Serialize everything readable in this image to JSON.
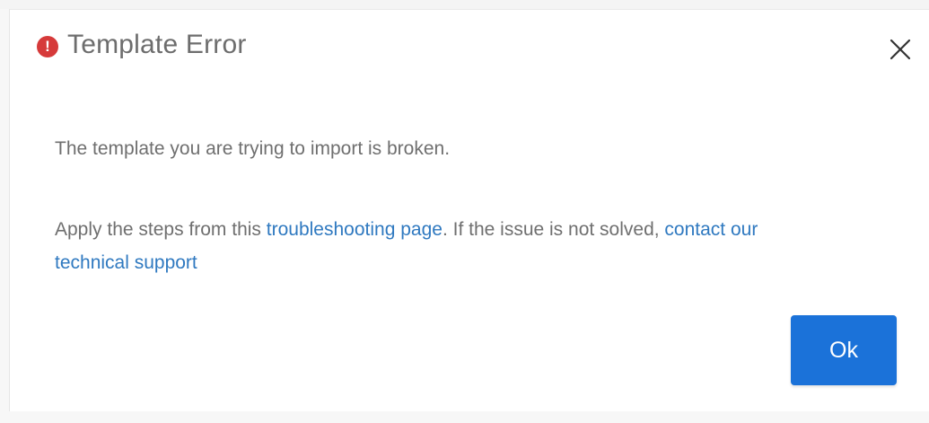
{
  "dialog": {
    "title": "Template Error",
    "paragraph1": "The template you are trying to import is broken.",
    "paragraph2": {
      "prefix": "Apply the steps from this ",
      "link1": "troubleshooting page",
      "middle": ". If the issue is not solved, ",
      "link2": "contact our technical support"
    },
    "ok_label": "Ok"
  },
  "icons": {
    "title_icon": "error-exclamation-icon",
    "close_icon": "close-icon"
  },
  "colors": {
    "error_red": "#d63a3a",
    "link_blue": "#2f79c0",
    "button_blue": "#1b72d9",
    "text_gray": "#6f6f6f"
  }
}
